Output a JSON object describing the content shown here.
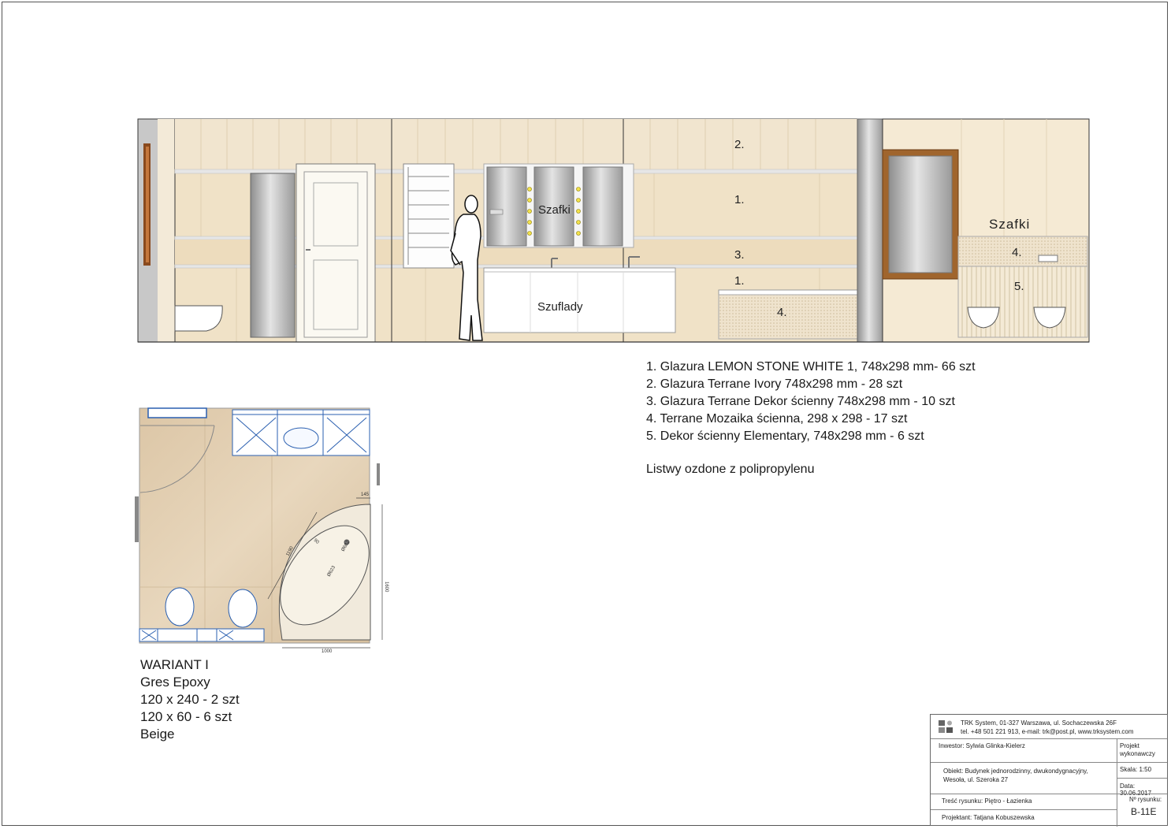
{
  "elevation": {
    "labels": {
      "num2": "2.",
      "num1_top": "1.",
      "num3": "3.",
      "num1_low": "1.",
      "num4_bath": "4.",
      "num4_right": "4.",
      "num5_right": "5.",
      "szafki_mirror": "Szafki",
      "szafki_right": "Szafki",
      "szuflady": "Szuflady"
    },
    "colors": {
      "tile": "#f0e2c7",
      "tile_light": "#f5ead4",
      "mirror": "#b9b9b9",
      "wood_frame": "#a0652d",
      "outline": "#333333"
    }
  },
  "legend": {
    "items": [
      "1. Glazura LEMON STONE WHITE 1, 748x298 mm- 66 szt",
      "2. Glazura Terrane Ivory 748x298 mm - 28 szt",
      "3. Glazura Terrane Dekor ścienny 748x298 mm - 10 szt",
      "4. Terrane Mozaika ścienna, 298 x 298 -  17 szt",
      "5. Dekor ścienny Elementary, 748x298 mm - 6 szt"
    ],
    "note": "Listwy ozdone z polipropylenu"
  },
  "plan": {
    "dims": {
      "d145": "145",
      "d1600": "1600",
      "d1000": "1000",
      "d1190": "1190",
      "d90": "90",
      "d682": "Ø682",
      "d623": "Ø623"
    }
  },
  "variant": {
    "lines": [
      "WARIANT I",
      "Gres Epoxy",
      "120 x 240 - 2 szt",
      "120 x 60 - 6 szt",
      "Beige"
    ]
  },
  "title_block": {
    "company_line1": "TRK System, 01-327 Warszawa, ul. Sochaczewska 26F",
    "company_line2": "tel. +48 501 221 913, e-mail: trk@post.pl, www.trksystem.com",
    "investor": "Inwestor: Sylwia Glinka-Kielerz",
    "project_type": "Projekt wykonawczy",
    "object_line1": "Obiekt: Budynek jednorodzinny, dwukondygnacyjny,",
    "object_line2": "Wesoła, ul. Szeroka 27",
    "scale": "Skala: 1:50",
    "date": "Data: 30.06.2017",
    "content": "Treść rysunku: Piętro - Łazienka",
    "drawing_no_label": "Nº rysunku:",
    "drawing_no": "B-11E",
    "designer": "Projektant: Tatjana Kobuszewska"
  }
}
